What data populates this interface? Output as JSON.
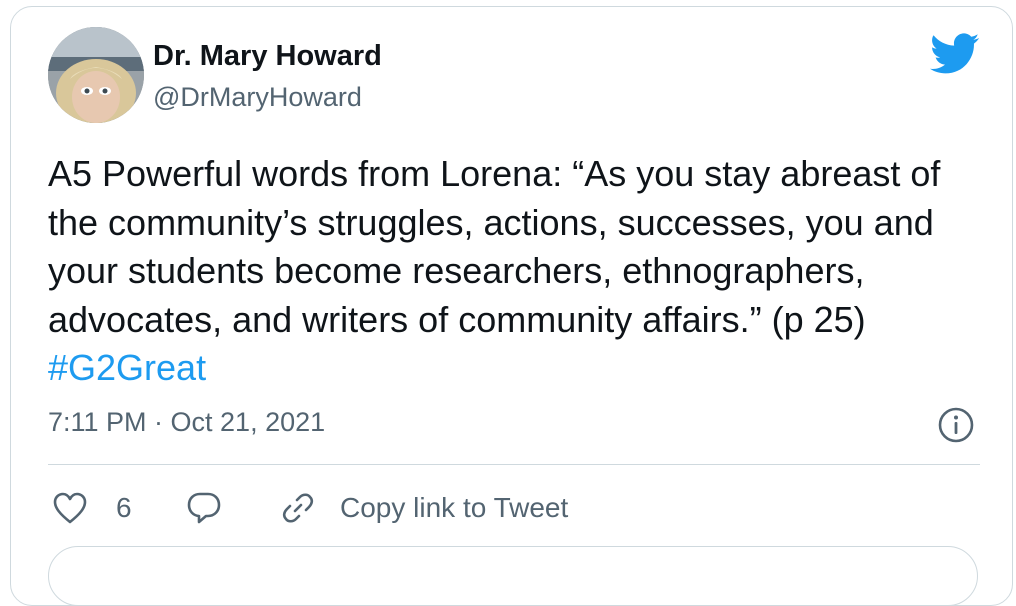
{
  "author": {
    "display_name": "Dr. Mary Howard",
    "handle": "@DrMaryHoward"
  },
  "tweet": {
    "text": "A5 Powerful words from Lorena: “As you stay abreast of the community’s struggles, actions, successes, you and your students become researchers, ethnographers, advocates, and writers of community affairs.” (p 25) ",
    "hashtag": "#G2Great",
    "timestamp": "7:11 PM · Oct 21, 2021"
  },
  "actions": {
    "like_count": "6",
    "copy_link_label": "Copy link to Tweet"
  },
  "colors": {
    "twitter_blue": "#1d9bf0",
    "text_primary": "#0f1419",
    "text_secondary": "#536471",
    "border": "#cfd9de"
  },
  "icons": [
    "avatar",
    "twitter-bird-icon",
    "info-icon",
    "heart-icon",
    "reply-icon",
    "link-icon"
  ]
}
